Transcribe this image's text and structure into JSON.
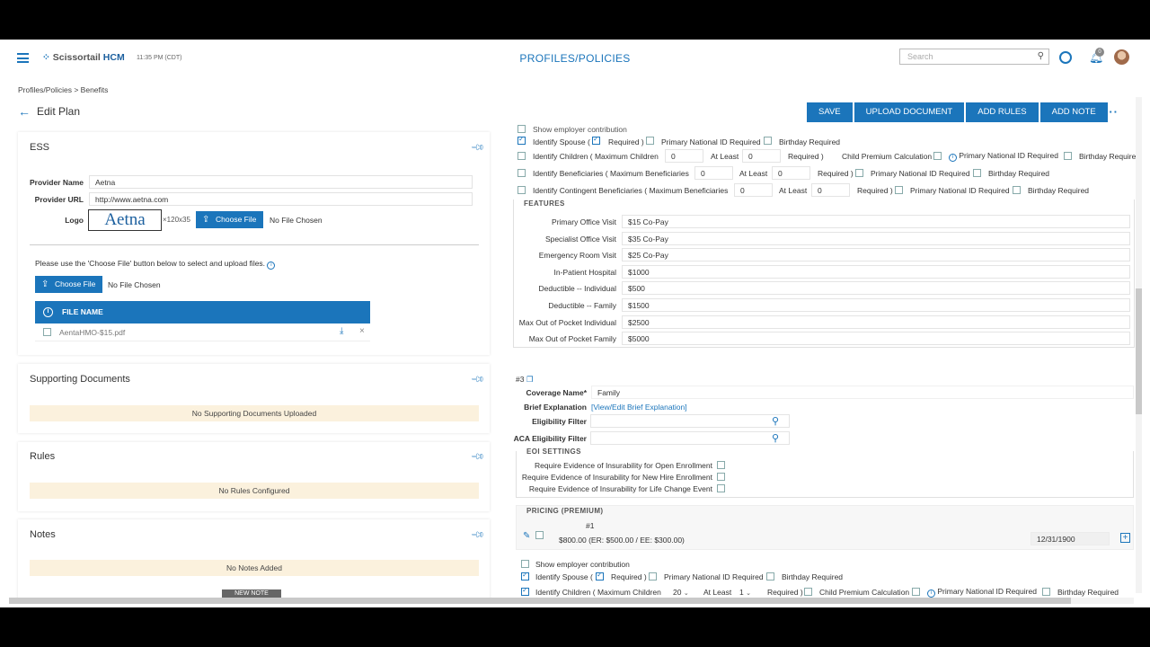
{
  "topbar": {
    "logo_text": "Scissortail",
    "logo_suffix": "HCM",
    "time": "11:35 PM (CDT)",
    "heading": "PROFILES/POLICIES",
    "search_placeholder": "Search",
    "notification_count": "0"
  },
  "breadcrumb": "Profiles/Policies  >  Benefits",
  "page_title": "Edit Plan",
  "actions": [
    "SAVE",
    "UPLOAD DOCUMENT",
    "ADD RULES",
    "ADD NOTE"
  ],
  "ess": {
    "title": "ESS",
    "provider_name_label": "Provider Name",
    "provider_name": "Aetna",
    "provider_url_label": "Provider URL",
    "provider_url": "http://www.aetna.com",
    "logo_label": "Logo",
    "logo_text": "Aetna",
    "logo_size": "×120x35",
    "choose_file": "Choose File",
    "no_file": "No File Chosen",
    "upload_hint": "Please use the 'Choose File' button below to select and upload files.",
    "file_header": "FILE NAME",
    "files": [
      "AentaHMO-$15.pdf"
    ]
  },
  "supporting_documents": {
    "title": "Supporting Documents",
    "empty": "No Supporting Documents Uploaded"
  },
  "rules": {
    "title": "Rules",
    "empty": "No Rules Configured"
  },
  "notes": {
    "title": "Notes",
    "empty": "No Notes Added",
    "new_note": "NEW NOTE"
  },
  "top_coverage": {
    "show_employer_contribution": "Show employer contribution",
    "identify_spouse": "Identify Spouse (",
    "required_close": "Required )",
    "primary_national_id": "Primary National ID Required",
    "birthday_required": "Birthday Required",
    "identify_children": "Identify Children ( Maximum Children",
    "children_max": "0",
    "at_least": "At Least",
    "children_min": "0",
    "child_premium": "Child Premium Calculation",
    "identify_beneficiaries": "Identify Beneficiaries ( Maximum Beneficiaries",
    "beneficiaries_max": "0",
    "beneficiaries_min": "0",
    "identify_contingent": "Identify Contingent Beneficiaries ( Maximum Beneficiaries",
    "contingent_max": "0",
    "contingent_min": "0"
  },
  "features": {
    "caption": "FEATURES",
    "rows": [
      {
        "label": "Primary Office Visit",
        "value": "$15 Co-Pay"
      },
      {
        "label": "Specialist Office Visit",
        "value": "$35 Co-Pay"
      },
      {
        "label": "Emergency Room Visit",
        "value": "$25 Co-Pay"
      },
      {
        "label": "In-Patient Hospital",
        "value": "$1000"
      },
      {
        "label": "Deductible -- Individual",
        "value": "$500"
      },
      {
        "label": "Deductible -- Family",
        "value": "$1500"
      },
      {
        "label": "Max Out of Pocket Individual",
        "value": "$2500"
      },
      {
        "label": "Max Out of Pocket Family",
        "value": "$5000"
      }
    ]
  },
  "coverage3": {
    "number": "#3",
    "coverage_name_label": "Coverage Name*",
    "coverage_name": "Family",
    "brief_label": "Brief Explanation",
    "brief_link": "[View/Edit Brief Explanation]",
    "eligibility_label": "Eligibility Filter",
    "aca_label": "ACA Eligibility Filter",
    "eoi_caption": "EOI SETTINGS",
    "eoi_open": "Require Evidence of Insurability for Open Enrollment",
    "eoi_newhire": "Require Evidence of Insurability for New Hire Enrollment",
    "eoi_life": "Require Evidence of Insurability for Life Change Event",
    "pricing_caption": "PRICING (PREMIUM)",
    "pricing_number": "#1",
    "pricing_text": "$800.00 (ER: $500.00 / EE: $300.00)",
    "pricing_date": "12/31/1900",
    "show_employer_contribution": "Show employer contribution",
    "identify_spouse": "Identify Spouse (",
    "required_close": "Required )",
    "primary_national_id": "Primary National ID Required",
    "birthday_required": "Birthday Required",
    "identify_children": "Identify Children ( Maximum Children",
    "children_max": "20",
    "at_least": "At Least",
    "children_min": "1",
    "child_premium": "Child Premium Calculation"
  }
}
